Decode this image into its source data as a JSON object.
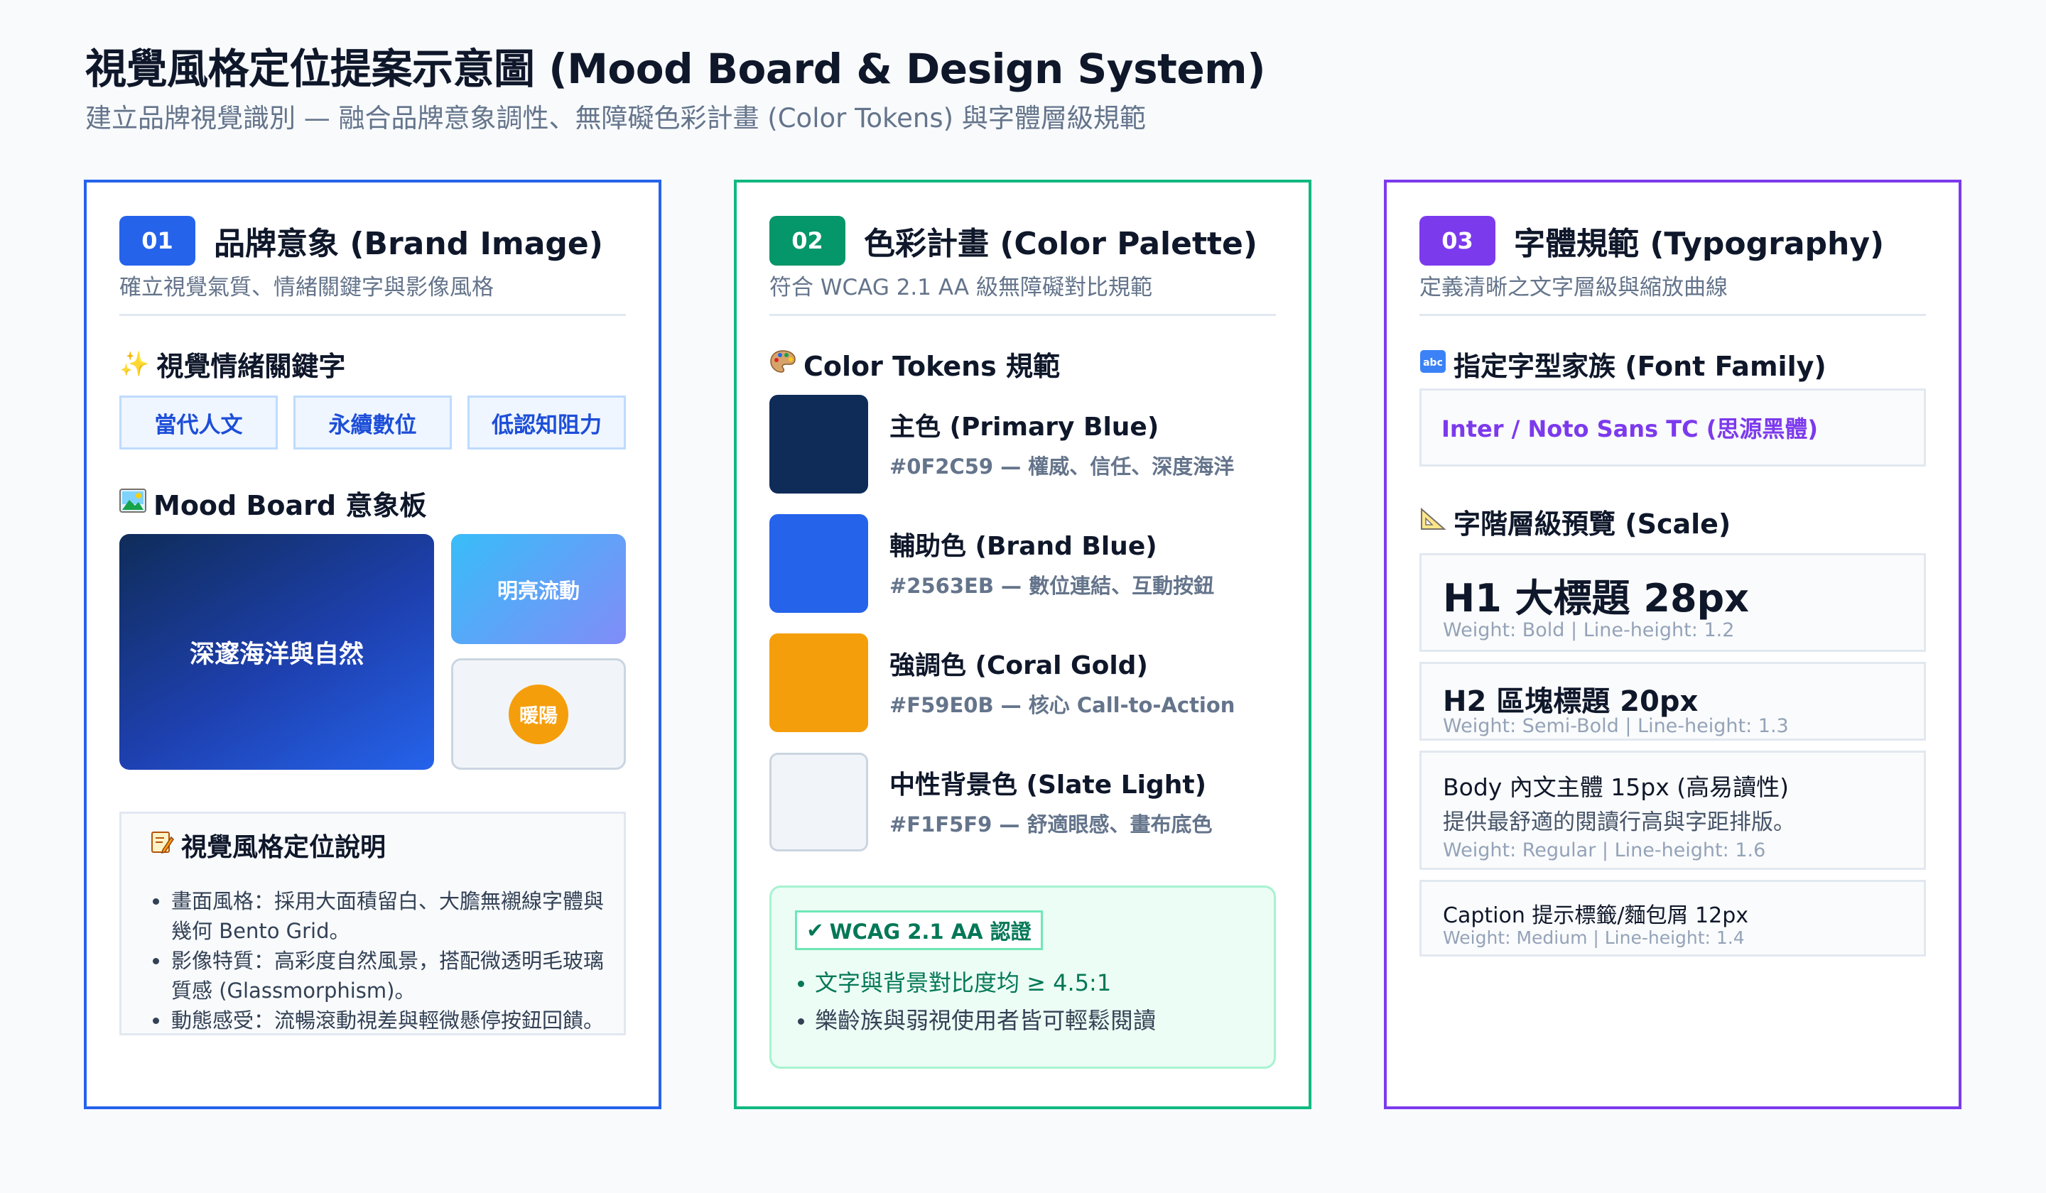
{
  "header": {
    "title": "視覺風格定位提案示意圖 (Mood Board & Design System)",
    "subtitle": "建立品牌視覺識別 — 融合品牌意象調性、無障礙色彩計畫 (Color Tokens) 與字體層級規範"
  },
  "panel_brand": {
    "number": "01",
    "title": "品牌意象 (Brand Image)",
    "desc": "確立視覺氣質、情緒關鍵字與影像風格",
    "keywords_title": "視覺情緒關鍵字",
    "keywords_icon": "sparkles-icon",
    "keywords": [
      "當代人文",
      "永續數位",
      "低認知阻力"
    ],
    "mood_title": "Mood Board 意象板",
    "mood_icon": "picture-icon",
    "mood_main": "深邃海洋與自然",
    "mood_flow": "明亮流動",
    "mood_sun": "暖陽",
    "note_title": "視覺風格定位說明",
    "note_icon": "memo-icon",
    "notes": [
      "畫面風格：採用大面積留白、大膽無襯線字體與幾何 Bento Grid。",
      "影像特質：高彩度自然風景，搭配微透明毛玻璃質感 (Glassmorphism)。",
      "動態感受：流暢滾動視差與輕微懸停按鈕回饋。"
    ]
  },
  "panel_color": {
    "number": "02",
    "title": "色彩計畫 (Color Palette)",
    "desc": "符合 WCAG 2.1 AA 級無障礙對比規範",
    "tokens_title": "Color Tokens 規範",
    "tokens_icon": "palette-icon",
    "colors": [
      {
        "name": "主色 (Primary Blue)",
        "desc": "#0F2C59 — 權威、信任、深度海洋",
        "hex": "#0F2C59"
      },
      {
        "name": "輔助色 (Brand Blue)",
        "desc": "#2563EB — 數位連結、互動按鈕",
        "hex": "#2563EB"
      },
      {
        "name": "強調色 (Coral Gold)",
        "desc": "#F59E0B — 核心 Call-to-Action",
        "hex": "#F59E0B"
      },
      {
        "name": "中性背景色 (Slate Light)",
        "desc": "#F1F5F9 — 舒適眼感、畫布底色",
        "hex": "#F1F5F9"
      }
    ],
    "wcag_badge": "WCAG 2.1 AA 認證",
    "wcag_icon": "check-icon",
    "wcag_points": [
      "文字與背景對比度均 ≥ 4.5:1",
      "樂齡族與弱視使用者皆可輕鬆閱讀"
    ]
  },
  "panel_type": {
    "number": "03",
    "title": "字體規範 (Typography)",
    "desc": "定義清晰之文字層級與縮放曲線",
    "family_title": "指定字型家族 (Font Family)",
    "family_icon": "abc-icon",
    "family_value": "Inter / Noto Sans TC (思源黑體)",
    "scale_title": "字階層級預覽 (Scale)",
    "scale_icon": "triangle-ruler-icon",
    "h1": {
      "label": "H1 大標題 28px",
      "meta": "Weight: Bold | Line-height: 1.2"
    },
    "h2": {
      "label": "H2 區塊標題 20px",
      "meta": "Weight: Semi-Bold | Line-height: 1.3"
    },
    "body": {
      "label": "Body 內文主體 15px (高易讀性)",
      "sample": "提供最舒適的閱讀行高與字距排版。",
      "meta": "Weight: Regular | Line-height: 1.6"
    },
    "caption": {
      "label": "Caption 提示標籤/麵包屑 12px",
      "meta": "Weight: Medium | Line-height: 1.4"
    }
  }
}
